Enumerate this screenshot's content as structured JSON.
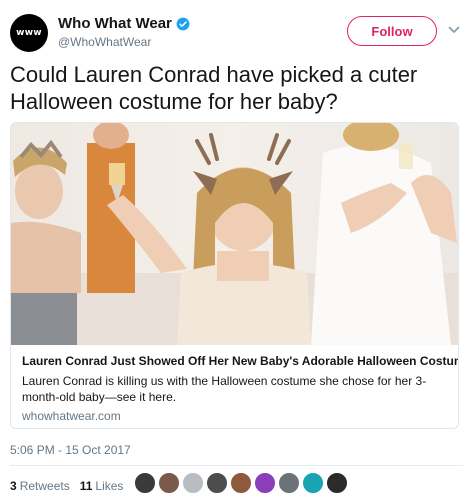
{
  "author": {
    "avatar_text": "www",
    "display_name": "Who What Wear",
    "handle": "@WhoWhatWear",
    "verified": true,
    "follow_label": "Follow"
  },
  "tweet": {
    "text": "Could Lauren Conrad have picked a cuter Halloween costume for her baby?",
    "timestamp": "5:06 PM - 15 Oct 2017"
  },
  "card": {
    "title": "Lauren Conrad Just Showed Off Her New Baby's Adorable Halloween Costume",
    "description": "Lauren Conrad is killing us with the Halloween costume she chose for her 3-month-old baby—see it here.",
    "domain": "whowhatwear.com"
  },
  "stats": {
    "retweets_count": "3",
    "retweets_label": "Retweets",
    "likes_count": "11",
    "likes_label": "Likes"
  },
  "likers": [
    {
      "name": "liker-avatar",
      "color": "#3a3a3a"
    },
    {
      "name": "liker-avatar",
      "color": "#7a5a4a"
    },
    {
      "name": "liker-avatar",
      "color": "#b9bcc0"
    },
    {
      "name": "liker-avatar",
      "color": "#4d4d4d"
    },
    {
      "name": "liker-avatar",
      "color": "#8e5a3c"
    },
    {
      "name": "liker-avatar",
      "color": "#8a3fb8"
    },
    {
      "name": "liker-avatar",
      "color": "#6b7278"
    },
    {
      "name": "liker-avatar",
      "color": "#1aa3b0"
    },
    {
      "name": "liker-avatar",
      "color": "#2b2b2b"
    }
  ],
  "colors": {
    "brand_pink": "#e0245e",
    "verified_blue": "#1da1f2",
    "muted": "#657786"
  },
  "icons": {
    "verified": "verified-badge-icon",
    "caret": "chevron-down-icon"
  }
}
